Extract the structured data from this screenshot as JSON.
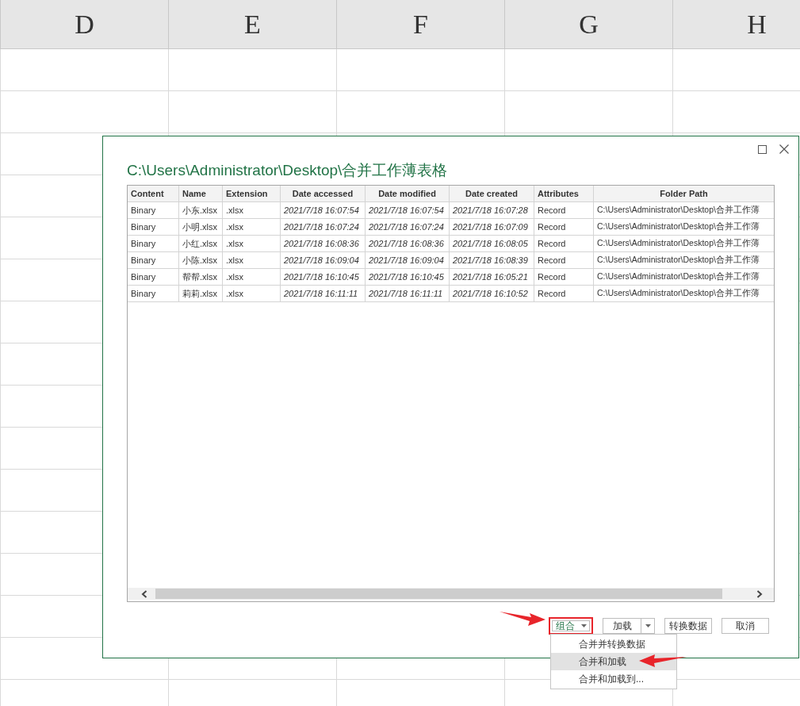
{
  "spreadsheet": {
    "columns": [
      "D",
      "E",
      "F",
      "G",
      "H"
    ]
  },
  "dialog": {
    "title": "C:\\Users\\Administrator\\Desktop\\合并工作薄表格",
    "table": {
      "columns": [
        {
          "label": "Content",
          "kind": "text"
        },
        {
          "label": "Name",
          "kind": "text"
        },
        {
          "label": "Extension",
          "kind": "text"
        },
        {
          "label": "Date accessed",
          "kind": "date"
        },
        {
          "label": "Date modified",
          "kind": "date"
        },
        {
          "label": "Date created",
          "kind": "date"
        },
        {
          "label": "Attributes",
          "kind": "text"
        },
        {
          "label": "Folder Path",
          "kind": "path"
        }
      ],
      "rows": [
        [
          "Binary",
          "小东.xlsx",
          ".xlsx",
          "2021/7/18 16:07:54",
          "2021/7/18 16:07:54",
          "2021/7/18 16:07:28",
          "Record",
          "C:\\Users\\Administrator\\Desktop\\合并工作薄"
        ],
        [
          "Binary",
          "小明.xlsx",
          ".xlsx",
          "2021/7/18 16:07:24",
          "2021/7/18 16:07:24",
          "2021/7/18 16:07:09",
          "Record",
          "C:\\Users\\Administrator\\Desktop\\合并工作薄"
        ],
        [
          "Binary",
          "小红.xlsx",
          ".xlsx",
          "2021/7/18 16:08:36",
          "2021/7/18 16:08:36",
          "2021/7/18 16:08:05",
          "Record",
          "C:\\Users\\Administrator\\Desktop\\合并工作薄"
        ],
        [
          "Binary",
          "小陈.xlsx",
          ".xlsx",
          "2021/7/18 16:09:04",
          "2021/7/18 16:09:04",
          "2021/7/18 16:08:39",
          "Record",
          "C:\\Users\\Administrator\\Desktop\\合并工作薄"
        ],
        [
          "Binary",
          "帮帮.xlsx",
          ".xlsx",
          "2021/7/18 16:10:45",
          "2021/7/18 16:10:45",
          "2021/7/18 16:05:21",
          "Record",
          "C:\\Users\\Administrator\\Desktop\\合并工作薄"
        ],
        [
          "Binary",
          "莉莉.xlsx",
          ".xlsx",
          "2021/7/18 16:11:11",
          "2021/7/18 16:11:11",
          "2021/7/18 16:10:52",
          "Record",
          "C:\\Users\\Administrator\\Desktop\\合并工作薄"
        ]
      ]
    },
    "buttons": [
      {
        "label": "组合",
        "kind": "dropdown",
        "highlighted": true
      },
      {
        "label": "加载",
        "kind": "split",
        "highlighted": false
      },
      {
        "label": "转换数据",
        "kind": "plain",
        "highlighted": false
      },
      {
        "label": "取消",
        "kind": "plain",
        "highlighted": false
      }
    ],
    "menu": {
      "items": [
        {
          "label": "合并并转换数据",
          "selected": false
        },
        {
          "label": "合并和加载",
          "selected": true
        },
        {
          "label": "合并和加载到...",
          "selected": false
        }
      ]
    }
  }
}
